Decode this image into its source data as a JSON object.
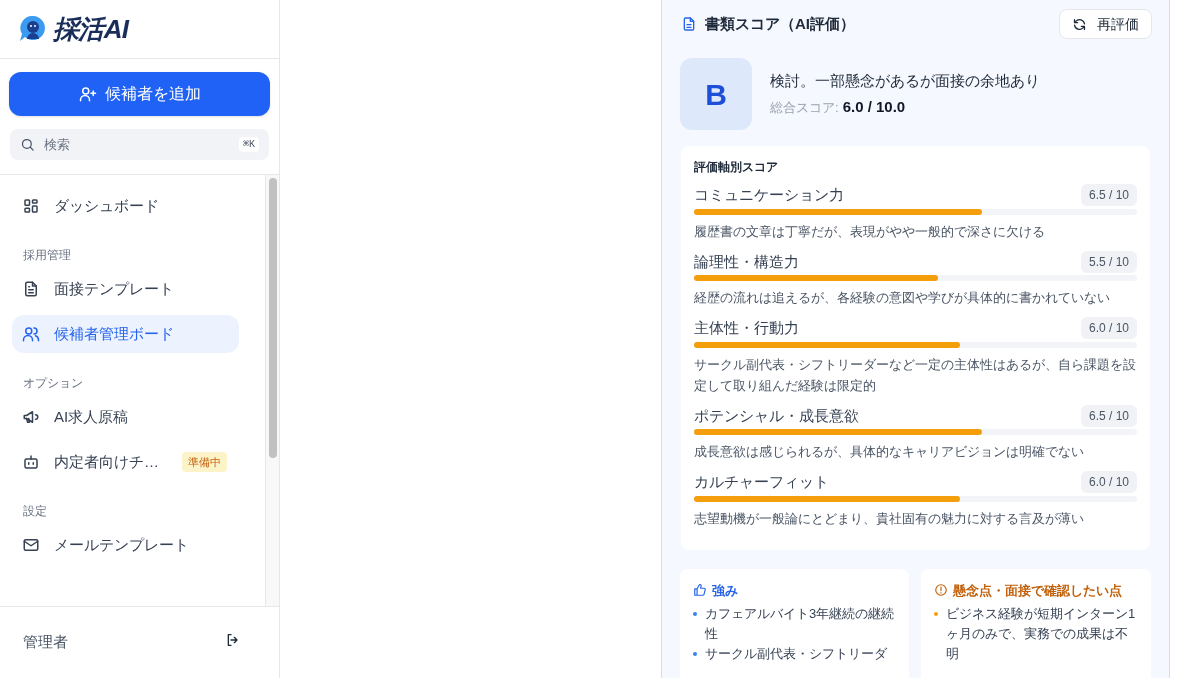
{
  "sidebar": {
    "logo": "採活AI",
    "add_button": "候補者を追加",
    "search": {
      "placeholder": "検索",
      "shortcut": "⌘K"
    },
    "nav": [
      {
        "kind": "item",
        "label": "ダッシュボード",
        "selected": false
      },
      {
        "kind": "section",
        "label": "採用管理"
      },
      {
        "kind": "item",
        "label": "面接テンプレート",
        "selected": false
      },
      {
        "kind": "item",
        "label": "候補者管理ボード",
        "selected": true
      },
      {
        "kind": "section",
        "label": "オプション"
      },
      {
        "kind": "item",
        "label": "AI求人原稿",
        "selected": false
      },
      {
        "kind": "item",
        "label": "内定者向けチ…",
        "selected": false,
        "badge": "準備中"
      },
      {
        "kind": "section",
        "label": "設定"
      },
      {
        "kind": "item",
        "label": "メールテンプレート",
        "selected": false
      }
    ],
    "user": "管理者"
  },
  "score_card": {
    "title": "書類スコア（AI評価）",
    "reevaluate_button": "再評価",
    "grade": "B",
    "summary": "検討。一部懸念があるが面接の余地あり",
    "total_label": "総合スコア:",
    "total_value": "6.0 / 10.0",
    "axes_title": "評価軸別スコア",
    "axes": [
      {
        "name": "コミュニケーション力",
        "score": "6.5 / 10",
        "level": 0.65,
        "comment": "履歴書の文章は丁寧だが、表現がやや一般的で深さに欠ける"
      },
      {
        "name": "論理性・構造力",
        "score": "5.5 / 10",
        "level": 0.55,
        "comment": "経歴の流れは追えるが、各経験の意図や学びが具体的に書かれていない"
      },
      {
        "name": "主体性・行動力",
        "score": "6.0 / 10",
        "level": 0.6,
        "comment": "サークル副代表・シフトリーダーなど一定の主体性はあるが、自ら課題を設定して取り組んだ経験は限定的"
      },
      {
        "name": "ポテンシャル・成長意欲",
        "score": "6.5 / 10",
        "level": 0.65,
        "comment": "成長意欲は感じられるが、具体的なキャリアビジョンは明確でない"
      },
      {
        "name": "カルチャーフィット",
        "score": "6.0 / 10",
        "level": 0.6,
        "comment": "志望動機が一般論にとどまり、貴社固有の魅力に対する言及が薄い"
      }
    ],
    "strengths": {
      "title": "強み",
      "items": [
        "カフェアルバイト3年継続の継続性",
        "サークル副代表・シフトリーダ"
      ]
    },
    "concerns": {
      "title": "懸念点・面接で確認したい点",
      "items": [
        "ビジネス経験が短期インターン1ヶ月のみで、実務での成果は不明"
      ]
    }
  }
}
